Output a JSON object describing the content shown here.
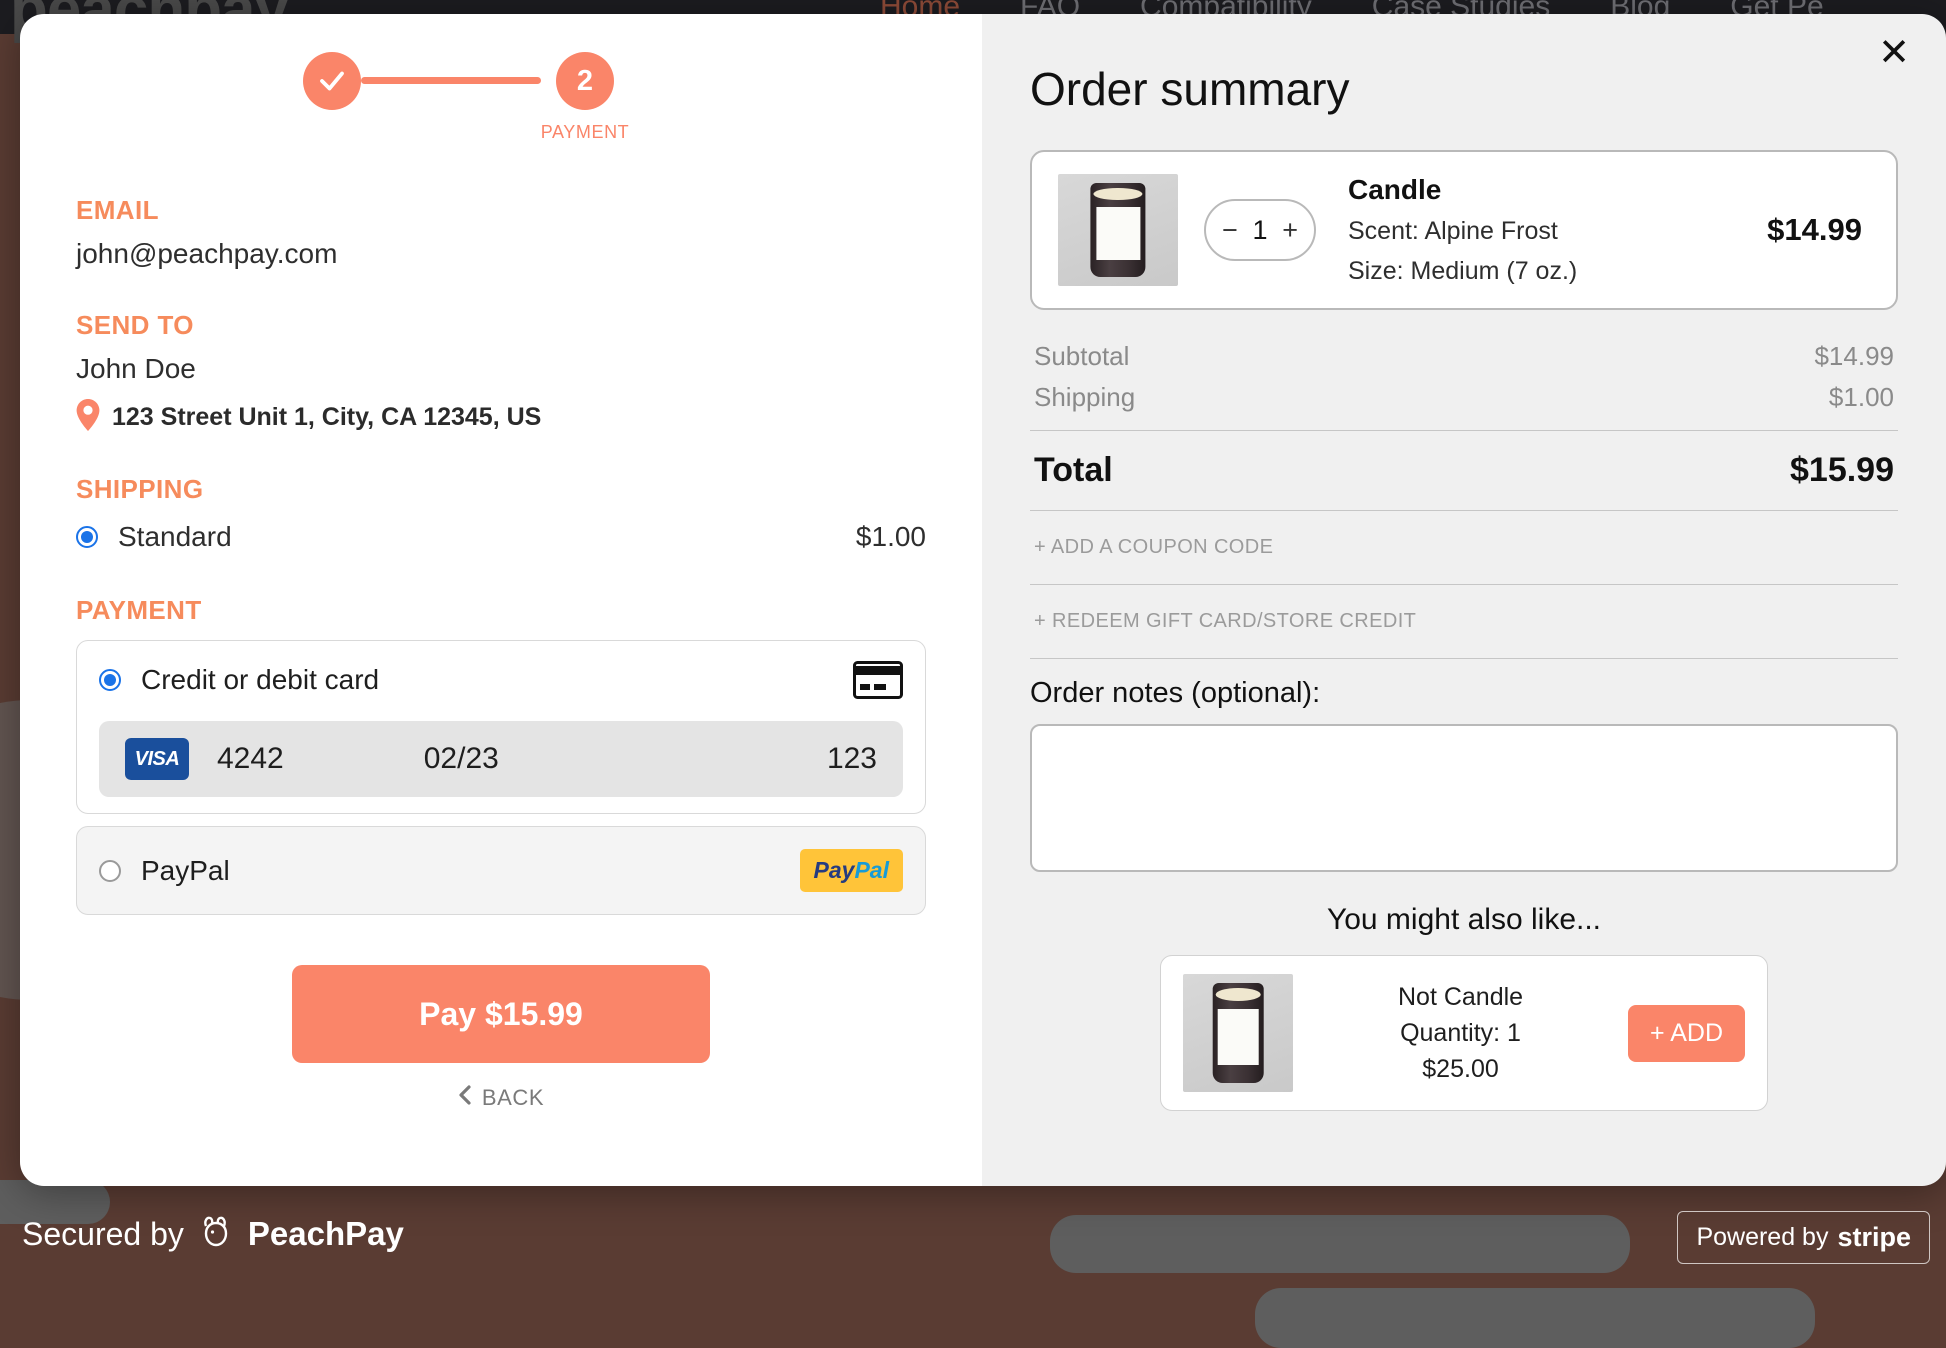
{
  "background": {
    "logo_text": "peachpay",
    "nav_items": [
      "Home",
      "FAQ",
      "Compatibility",
      "Case Studies",
      "Blog",
      "Get Pe"
    ]
  },
  "stepper": {
    "step1_icon": "check-icon",
    "step2_number": "2",
    "step2_label": "PAYMENT"
  },
  "left": {
    "email_heading": "EMAIL",
    "email_value": "john@peachpay.com",
    "sendto_heading": "SEND TO",
    "recipient_name": "John Doe",
    "address": "123 Street Unit 1, City, CA 12345, US",
    "shipping_heading": "SHIPPING",
    "shipping_method": "Standard",
    "shipping_price": "$1.00",
    "payment_heading": "PAYMENT",
    "card_option_label": "Credit or debit card",
    "card_brand": "VISA",
    "card_number": "4242",
    "card_expiry": "02/23",
    "card_cvc": "123",
    "paypal_option_label": "PayPal",
    "paypal_logo_part1": "Pay",
    "paypal_logo_part2": "Pal",
    "pay_button_label": "Pay $15.99",
    "back_label": "BACK"
  },
  "right": {
    "title": "Order summary",
    "close_label": "✕",
    "cart_item": {
      "name": "Candle",
      "scent": "Scent: Alpine Frost",
      "size": "Size: Medium (7 oz.)",
      "price": "$14.99",
      "quantity": "1",
      "decrement_label": "−",
      "increment_label": "+"
    },
    "subtotal_label": "Subtotal",
    "subtotal_value": "$14.99",
    "shipping_label": "Shipping",
    "shipping_value": "$1.00",
    "total_label": "Total",
    "total_value": "$15.99",
    "coupon_link": "+ ADD A COUPON CODE",
    "giftcard_link": "+ REDEEM GIFT CARD/STORE CREDIT",
    "notes_label": "Order notes (optional):",
    "notes_value": "",
    "notes_placeholder": "",
    "upsell_title": "You might also like...",
    "upsell_item": {
      "name": "Not Candle",
      "quantity": "Quantity: 1",
      "price": "$25.00",
      "add_label": "+ ADD"
    }
  },
  "footer": {
    "secured_text": "Secured by",
    "brand": "PeachPay",
    "stripe_prefix": "Powered by",
    "stripe_word": "stripe"
  },
  "colors": {
    "accent": "#FA8569",
    "heading_accent": "#F68B5C",
    "radio_blue": "#1a73e8",
    "page_bg": "#5a3c33",
    "panel_bg": "#f0f0f0"
  }
}
